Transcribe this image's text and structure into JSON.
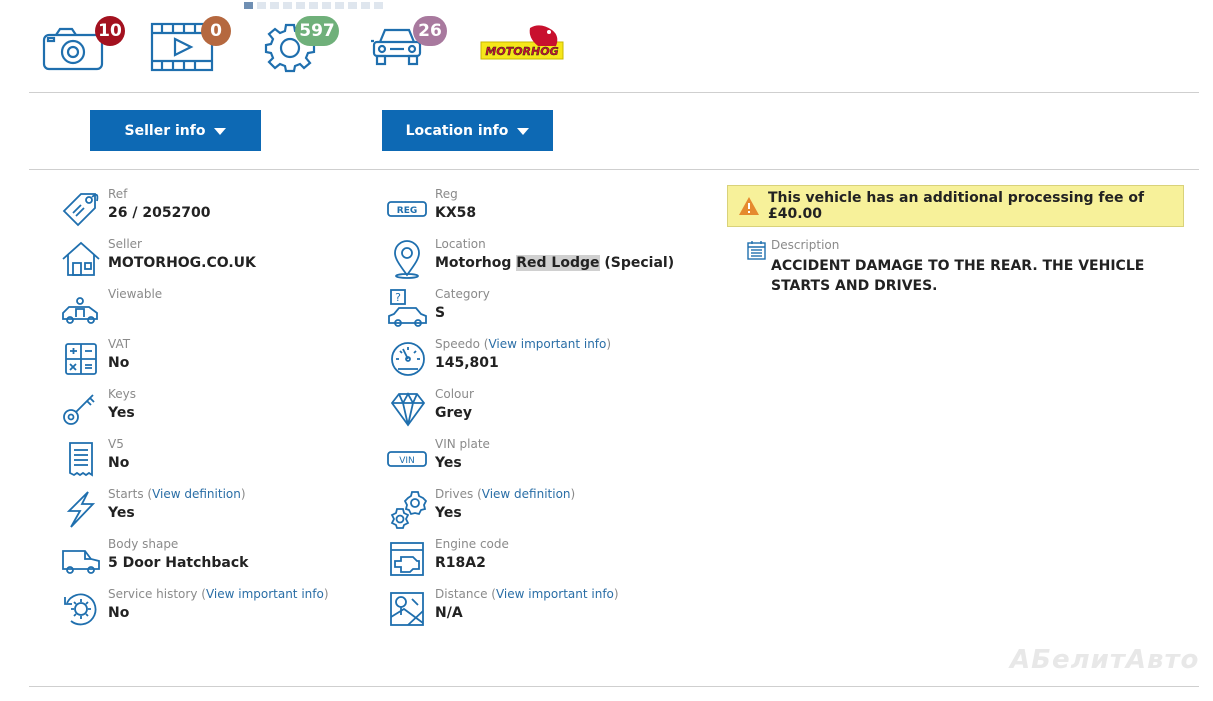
{
  "top": {
    "photos_count": "10",
    "videos_count": "0",
    "parts_count": "597",
    "vehicles_count": "26",
    "logo_text": "MOTORHOG",
    "badge_colors": {
      "photos": "#a3111f",
      "videos": "#b5683f",
      "parts": "#6fb07a",
      "vehicles": "#a8799e"
    }
  },
  "buttons": {
    "seller_label": "Seller info",
    "location_label": "Location info"
  },
  "left": [
    {
      "label": "Ref",
      "value": "26 / 2052700",
      "icon": "tag-icon"
    },
    {
      "label": "Seller",
      "value": "MOTORHOG.CO.UK",
      "icon": "house-icon"
    },
    {
      "label": "Viewable",
      "value": "",
      "icon": "car-person-icon"
    },
    {
      "label": "VAT",
      "value": "No",
      "icon": "calculator-icon"
    },
    {
      "label": "Keys",
      "value": "Yes",
      "icon": "key-icon"
    },
    {
      "label": "V5",
      "value": "No",
      "icon": "document-icon"
    },
    {
      "label": "Starts",
      "link": "View definition",
      "value": "Yes",
      "icon": "lightning-icon"
    },
    {
      "label": "Body shape",
      "value": "5 Door Hatchback",
      "icon": "van-icon"
    },
    {
      "label": "Service history",
      "link": "View important info",
      "value": "No",
      "icon": "service-gear-icon"
    }
  ],
  "mid": [
    {
      "label": "Reg",
      "value": "KX58",
      "icon": "reg-plate-icon",
      "icon_text": "REG"
    },
    {
      "label": "Location",
      "value_pre": "Motorhog ",
      "value_hl": "Red Lodge",
      "value_post": " (Special)",
      "icon": "map-pin-icon"
    },
    {
      "label": "Category",
      "value": "S",
      "icon": "car-question-icon",
      "icon_text": "?"
    },
    {
      "label": "Speedo",
      "link": "View important info",
      "value": "145,801",
      "icon": "speedometer-icon"
    },
    {
      "label": "Colour",
      "value": "Grey",
      "icon": "diamond-icon"
    },
    {
      "label": "VIN plate",
      "value": "Yes",
      "icon": "vin-plate-icon",
      "icon_text": "VIN"
    },
    {
      "label": "Drives",
      "link": "View definition",
      "value": "Yes",
      "icon": "gears-icon"
    },
    {
      "label": "Engine code",
      "value": "R18A2",
      "icon": "engine-code-icon"
    },
    {
      "label": "Distance",
      "link": "View important info",
      "value": "N/A",
      "icon": "map-distance-icon"
    }
  ],
  "warning": {
    "text": "This vehicle has an additional processing fee of £40.00"
  },
  "description": {
    "label": "Description",
    "value": "ACCIDENT DAMAGE TO THE REAR. THE VEHICLE STARTS AND DRIVES."
  },
  "watermark": "АБелитАвто"
}
